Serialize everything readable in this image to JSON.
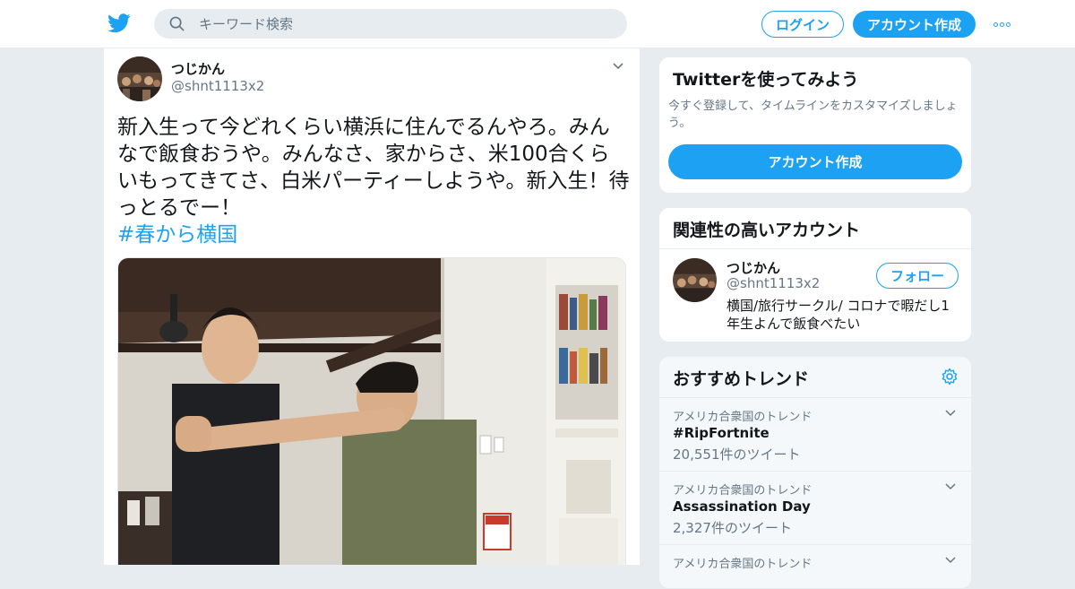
{
  "header": {
    "search_placeholder": "キーワード検索",
    "login_label": "ログイン",
    "signup_label": "アカウント作成"
  },
  "tweet": {
    "name": "つじかん",
    "handle": "@shnt1113x2",
    "text": "新入生って今どれくらい横浜に住んでるんやろ。みんなで飯食おうや。みんなさ、家からさ、米100合くらいもってきてさ、白米パーティーしようや。新入生！待っとるでー！",
    "hashtag": "#春から横国"
  },
  "signup_card": {
    "title": "Twitterを使ってみよう",
    "description": "今すぐ登録して、タイムラインをカスタマイズしましょう。",
    "cta_label": "アカウント作成"
  },
  "related_card": {
    "title": "関連性の高いアカウント",
    "account": {
      "name": "つじかん",
      "handle": "@shnt1113x2",
      "follow_label": "フォロー",
      "bio": "横国/旅行サークル/ コロナで暇だし1年生よんで飯食べたい"
    }
  },
  "trends_card": {
    "title": "おすすめトレンド",
    "items": [
      {
        "context": "アメリカ合衆国のトレンド",
        "name": "#RipFortnite",
        "count": "20,551件のツイート"
      },
      {
        "context": "アメリカ合衆国のトレンド",
        "name": "Assassination Day",
        "count": "2,327件のツイート"
      },
      {
        "context": "アメリカ合衆国のトレンド",
        "name": "",
        "count": ""
      }
    ]
  },
  "colors": {
    "accent": "#1da1f2",
    "background": "#e6ecf0",
    "muted_text": "#657786"
  }
}
